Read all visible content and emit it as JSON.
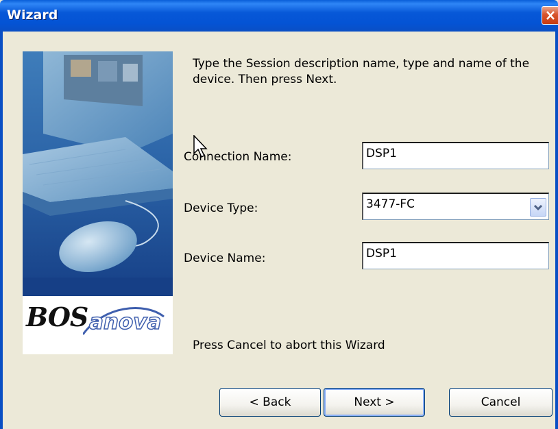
{
  "window": {
    "title": "Wizard"
  },
  "instructions": "Type the Session description name, type and name of the device. Then press Next.",
  "form": {
    "connection_name_label": "Connection Name:",
    "connection_name_value": "DSP1",
    "device_type_label": "Device Type:",
    "device_type_value": "3477-FC",
    "device_name_label": "Device Name:",
    "device_name_value": "DSP1"
  },
  "footer_text": "Press Cancel to abort this Wizard",
  "buttons": {
    "back": "< Back",
    "next": "Next >",
    "cancel": "Cancel"
  },
  "logo": {
    "part1": "BOS",
    "part2": "anova"
  },
  "icons": {
    "close": "close-icon",
    "dropdown": "chevron-down-icon",
    "cursor": "mouse-pointer-icon"
  },
  "colors": {
    "titlebar": "#0453d4",
    "dialog_bg": "#ece9d8",
    "close_btn": "#d8532c"
  }
}
